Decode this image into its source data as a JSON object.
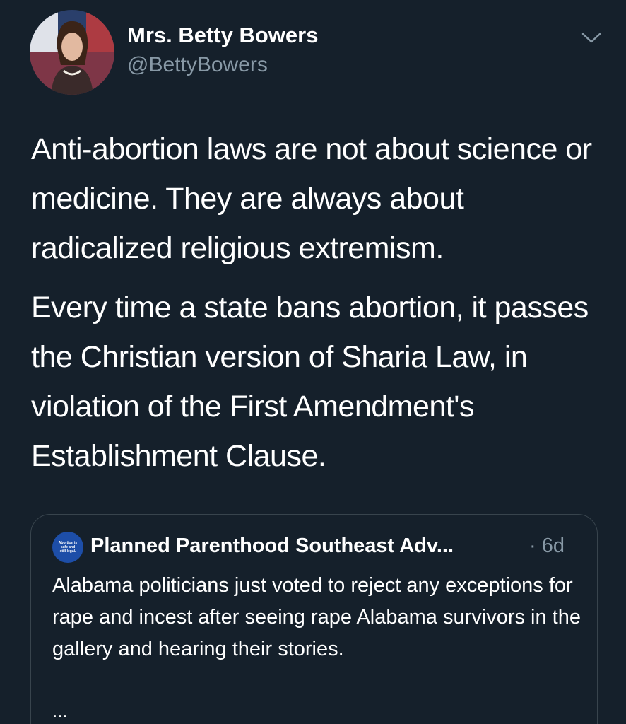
{
  "author": {
    "display_name": "Mrs. Betty Bowers",
    "handle": "@BettyBowers",
    "avatar_icon": "profile-photo-american-flag"
  },
  "menu": {
    "icon": "chevron-down-icon"
  },
  "tweet": {
    "paragraphs": [
      "Anti-abortion laws are not about science or medicine. They are always about radicalized religious extremism.",
      "Every time a state bans abortion, it passes the Christian version of Sharia Law, in violation of the First Amendment's Establishment Clause."
    ]
  },
  "quoted_tweet": {
    "avatar_text": "Abortion is safe and still legal.",
    "author_name": "Planned Parenthood Southeast Adv...",
    "time": "· 6d",
    "text": "Alabama politicians just voted to reject any exceptions for rape and incest after seeing rape Alabama survivors in the gallery and hearing their stories.",
    "more": "..."
  },
  "colors": {
    "background": "#15202b",
    "secondary_text": "#8899a6",
    "border": "#38444d",
    "quote_avatar": "#1d4ea8"
  }
}
